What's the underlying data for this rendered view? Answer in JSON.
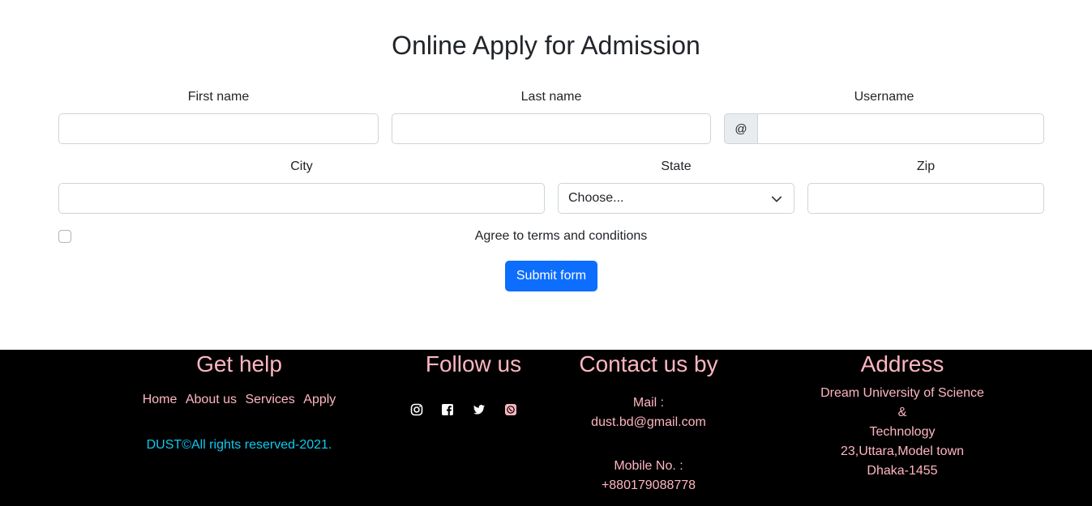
{
  "form": {
    "title": "Online Apply for Admission",
    "first_name_label": "First name",
    "last_name_label": "Last name",
    "username_label": "Username",
    "username_prefix": "@",
    "city_label": "City",
    "state_label": "State",
    "state_selected": "Choose...",
    "zip_label": "Zip",
    "terms_label": "Agree to terms and conditions",
    "submit_label": "Submit form"
  },
  "footer": {
    "help": {
      "heading": "Get help",
      "links": [
        "Home",
        "About us",
        "Services",
        "Apply"
      ],
      "copyright": "DUST©All rights reserved-2021."
    },
    "follow": {
      "heading": "Follow us",
      "icons": [
        "instagram-icon",
        "facebook-icon",
        "twitter-icon",
        "whatsapp-icon"
      ]
    },
    "contact": {
      "heading": "Contact us by",
      "mail_label": "Mail :",
      "mail_value": "dust.bd@gmail.com",
      "mobile_label": "Mobile No. :",
      "mobile_value": "+880179088778"
    },
    "address": {
      "heading": "Address",
      "line1": "Dream University of Science",
      "line2": "&",
      "line3": "Technology",
      "line4": "23,Uttara,Model town",
      "line5": "Dhaka-1455"
    }
  },
  "colors": {
    "accent": "#0d6efd",
    "footer_bg": "#000000",
    "footer_text": "#ffb6c1",
    "copyright_text": "#0dcaf0"
  }
}
